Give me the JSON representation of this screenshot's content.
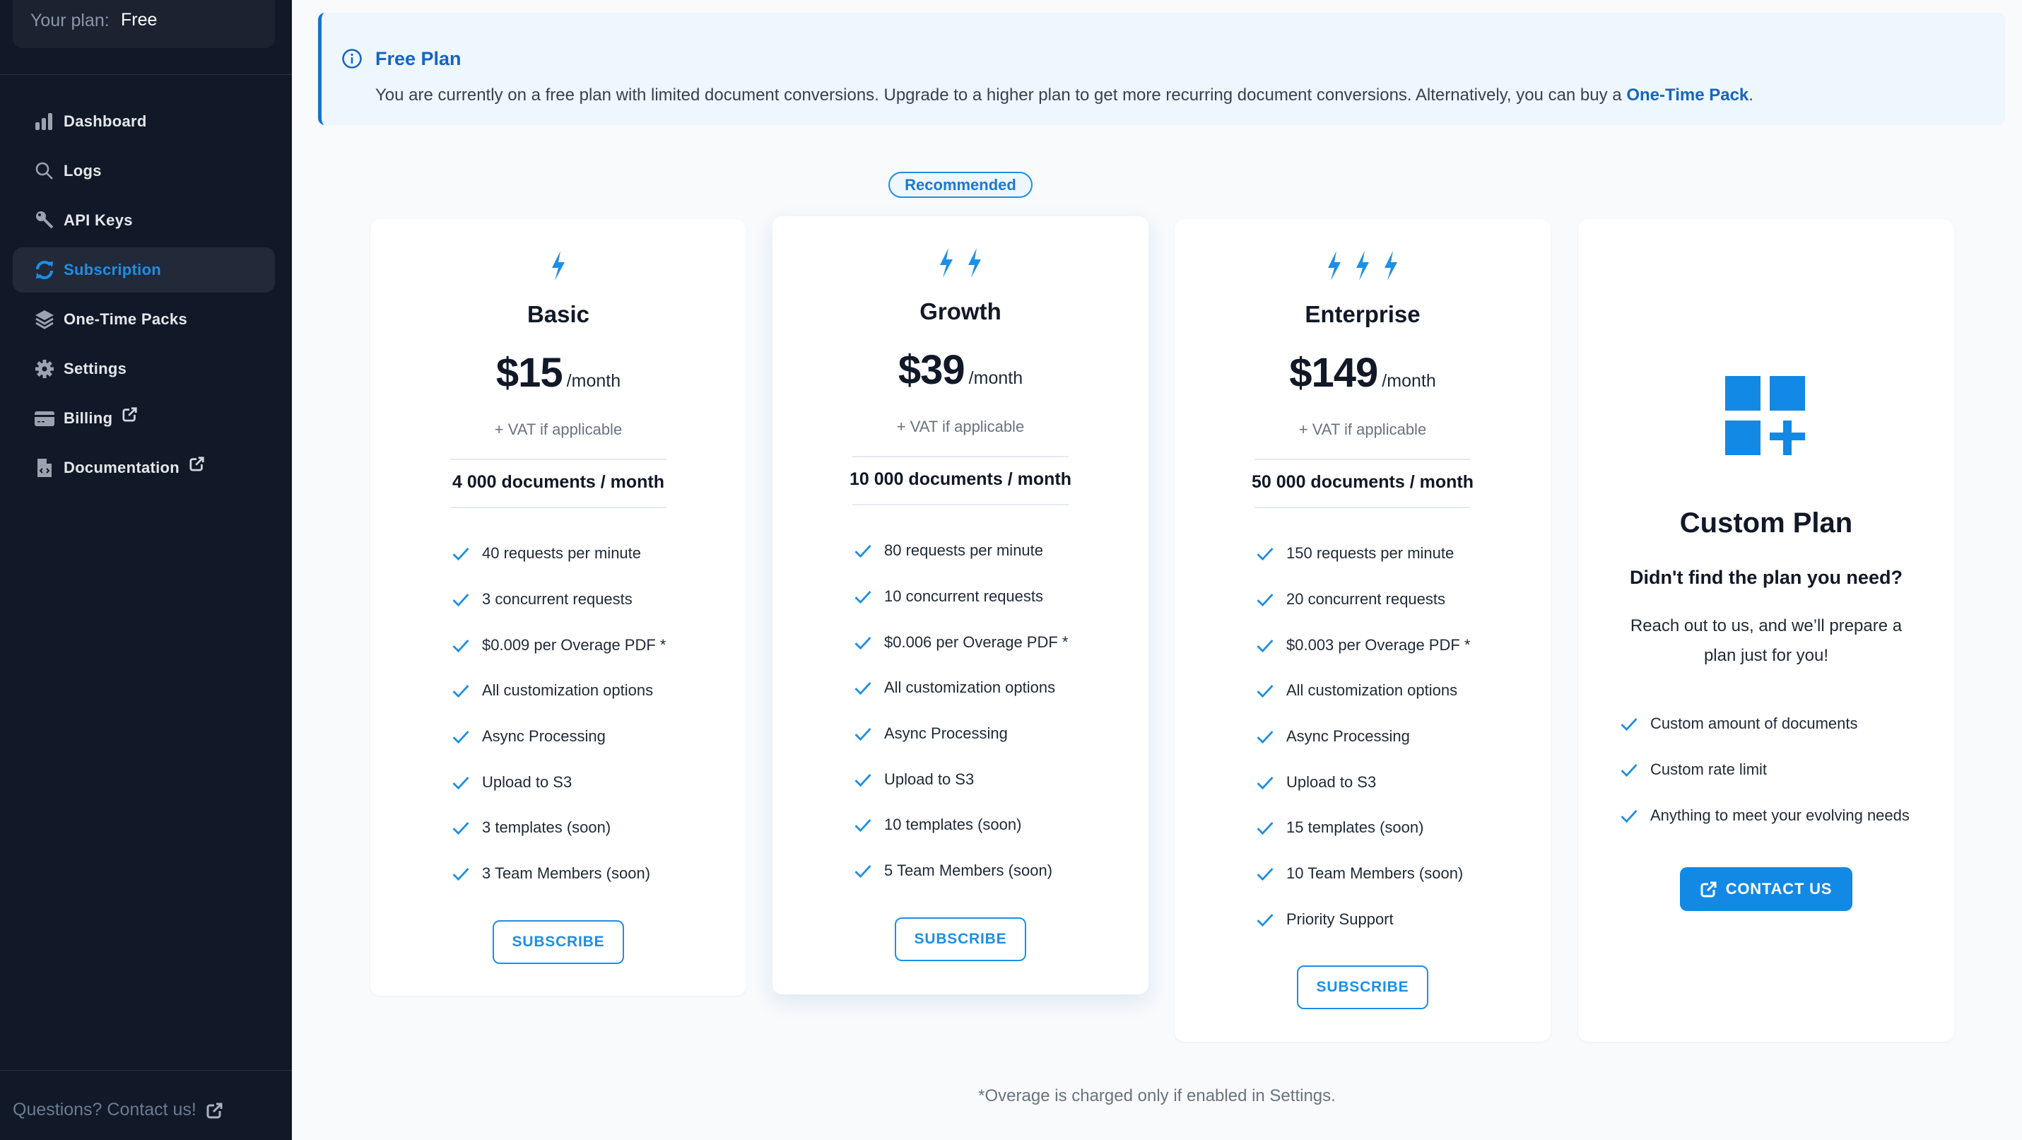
{
  "sidebar": {
    "plan_label": "Your plan:",
    "plan_value": "Free",
    "items": [
      {
        "label": "Dashboard",
        "icon": "bar-chart-icon",
        "active": false,
        "external": false
      },
      {
        "label": "Logs",
        "icon": "search-icon",
        "active": false,
        "external": false
      },
      {
        "label": "API Keys",
        "icon": "key-icon",
        "active": false,
        "external": false
      },
      {
        "label": "Subscription",
        "icon": "refresh-icon",
        "active": true,
        "external": false
      },
      {
        "label": "One-Time Packs",
        "icon": "layers-icon",
        "active": false,
        "external": false
      },
      {
        "label": "Settings",
        "icon": "gear-icon",
        "active": false,
        "external": false
      },
      {
        "label": "Billing",
        "icon": "credit-card-icon",
        "active": false,
        "external": true
      },
      {
        "label": "Documentation",
        "icon": "code-file-icon",
        "active": false,
        "external": true
      }
    ],
    "contact_label": "Questions? Contact us!"
  },
  "alert": {
    "title": "Free Plan",
    "message": "You are currently on a free plan with limited document conversions. Upgrade to a higher plan to get more recurring document conversions. Alternatively, you can buy a ",
    "link_text": "One-Time Pack",
    "message_end": "."
  },
  "colors": {
    "accent": "#1d8fe6",
    "sidebar_bg": "#111827",
    "alert_bg": "#eef6fe",
    "alert_title": "#1565c0"
  },
  "recommended_badge": "Recommended",
  "plans": [
    {
      "name": "Basic",
      "bolts": 1,
      "price": "$15",
      "period": "/month",
      "vat": "+ VAT if applicable",
      "documents": "4 000 documents / month",
      "features": [
        "40 requests per minute",
        "3 concurrent requests",
        "$0.009 per Overage PDF *",
        "All customization options",
        "Async Processing",
        "Upload to S3",
        "3 templates (soon)",
        "3 Team Members (soon)"
      ],
      "button": "SUBSCRIBE"
    },
    {
      "name": "Growth",
      "bolts": 2,
      "price": "$39",
      "period": "/month",
      "vat": "+ VAT if applicable",
      "documents": "10 000 documents / month",
      "features": [
        "80 requests per minute",
        "10 concurrent requests",
        "$0.006 per Overage PDF *",
        "All customization options",
        "Async Processing",
        "Upload to S3",
        "10 templates (soon)",
        "5 Team Members (soon)"
      ],
      "button": "SUBSCRIBE"
    },
    {
      "name": "Enterprise",
      "bolts": 3,
      "price": "$149",
      "period": "/month",
      "vat": "+ VAT if applicable",
      "documents": "50 000 documents / month",
      "features": [
        "150 requests per minute",
        "20 concurrent requests",
        "$0.003 per Overage PDF *",
        "All customization options",
        "Async Processing",
        "Upload to S3",
        "15 templates (soon)",
        "10 Team Members (soon)",
        "Priority Support"
      ],
      "button": "SUBSCRIBE"
    }
  ],
  "custom_plan": {
    "title": "Custom Plan",
    "question": "Didn't find the plan you need?",
    "description": "Reach out to us, and we’ll prepare a plan just for you!",
    "features": [
      "Custom amount of documents",
      "Custom rate limit",
      "Anything to meet your evolving needs"
    ],
    "button": "CONTACT US"
  },
  "footnote": "*Overage is charged only if enabled in Settings."
}
